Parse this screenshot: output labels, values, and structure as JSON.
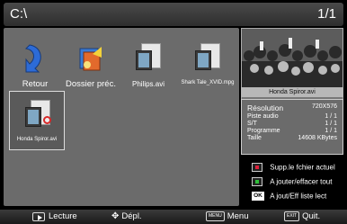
{
  "header": {
    "path": "C:\\",
    "page": "1/1"
  },
  "files": [
    {
      "label": "Retour",
      "icon": "return-arrow-icon"
    },
    {
      "label": "Dossier préc.",
      "icon": "parent-folder-icon"
    },
    {
      "label": "Philips.avi",
      "icon": "video-file-icon"
    },
    {
      "label": "Shark Tale_XVID.mpg",
      "icon": "video-file-icon"
    },
    {
      "label": "Honda Spiror.avi",
      "icon": "video-file-icon",
      "selected": true
    }
  ],
  "preview": {
    "name": "Honda Spiror.avi"
  },
  "info": {
    "resolution_label": "Résolution",
    "resolution_value": "720X576",
    "audio_label": "Piste audio",
    "audio_value": "1 / 1",
    "subtitle_label": "S/T",
    "subtitle_value": "1 / 1",
    "program_label": "Programme",
    "program_value": "1 / 1",
    "size_label": "Taille",
    "size_value": "14608 KBytes"
  },
  "actions": [
    {
      "label": "Supp.le fchier actuel",
      "color": "#e0203a"
    },
    {
      "label": "A jouter/effacer tout",
      "color": "#2fbf3a"
    },
    {
      "key": "OK",
      "label": "A jout/Eff liste lect"
    }
  ],
  "footer": {
    "play_label": "Lecture",
    "move_label": "Dépl.",
    "menu_key": "MENU",
    "menu_label": "Menu",
    "exit_key": "EXIT",
    "exit_label": "Quit."
  }
}
